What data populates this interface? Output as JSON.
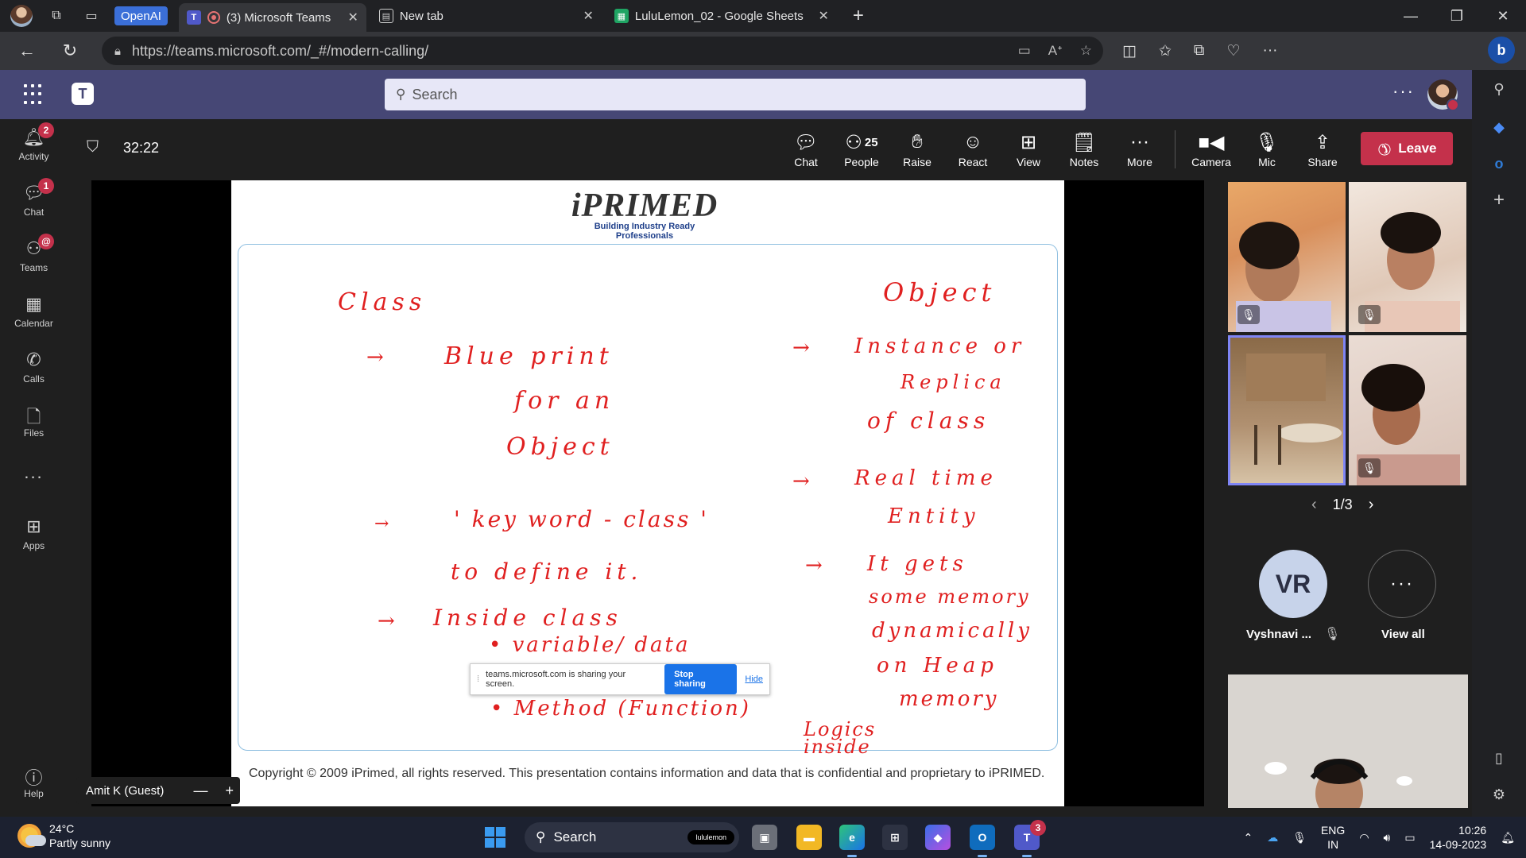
{
  "browser": {
    "openai_chip": "OpenAI",
    "tabs": [
      {
        "title": "(3) Microsoft Teams",
        "active": true
      },
      {
        "title": "New tab",
        "active": false
      },
      {
        "title": "LuluLemon_02 - Google Sheets",
        "active": false
      }
    ],
    "url": "https://teams.microsoft.com/_#/modern-calling/"
  },
  "teams": {
    "search_placeholder": "Search",
    "rail": [
      {
        "label": "Activity",
        "badge": "2",
        "icon": "bell-icon"
      },
      {
        "label": "Chat",
        "badge": "1",
        "icon": "chat-icon"
      },
      {
        "label": "Teams",
        "badge": "@",
        "icon": "teams-icon"
      },
      {
        "label": "Calendar",
        "badge": "",
        "icon": "calendar-icon"
      },
      {
        "label": "Calls",
        "badge": "",
        "icon": "phone-icon"
      },
      {
        "label": "Files",
        "badge": "",
        "icon": "file-icon"
      },
      {
        "label": "...",
        "badge": "",
        "icon": "more-icon"
      },
      {
        "label": "Apps",
        "badge": "",
        "icon": "apps-icon"
      },
      {
        "label": "Help",
        "badge": "",
        "icon": "help-icon"
      }
    ]
  },
  "meeting": {
    "timer": "32:22",
    "toolbar": {
      "chat": "Chat",
      "people": "People",
      "people_count": "25",
      "raise": "Raise",
      "react": "React",
      "view": "View",
      "notes": "Notes",
      "more": "More",
      "camera": "Camera",
      "mic": "Mic",
      "share": "Share",
      "leave": "Leave"
    },
    "presenter_name": "Amit K (Guest)",
    "pager": "1/3",
    "participant_initials": "VR",
    "participant_name": "Vyshnavi ...",
    "view_all": "View all"
  },
  "slide": {
    "logo_brand": "iPRIMED",
    "logo_tagline": "Building Industry Ready Professionals",
    "left_column": {
      "heading": "Class",
      "point1_arrow": "→",
      "point1_line1": "Blue print",
      "point1_line2": "for an",
      "point1_line3": "Object",
      "point2_arrow": "→",
      "point2_line1": "' key word - class '",
      "point2_line2": "to define it.",
      "point3_arrow": "→",
      "point3_line1": "Inside class",
      "point3_line2": "• variable/ data",
      "point3_line3": "• Method (Function)",
      "note": "Logics inside"
    },
    "right_column": {
      "heading": "Object",
      "point1_arrow": "→",
      "point1_line1": "Instance or",
      "point1_line2": "Replica",
      "point1_line3": "of class",
      "point2_arrow": "→",
      "point2_line1": "Real time",
      "point2_line2": "Entity",
      "point3_arrow": "→",
      "point3_line1": "It gets",
      "point3_line2": "some memory",
      "point3_line3": "dynamically",
      "point3_line4": "on Heap",
      "point3_line5": "memory"
    },
    "copyright": "Copyright © 2009 iPrimed, all rights reserved. This presentation contains information  and data  that is confidential and proprietary to iPRIMED.",
    "share_notice": "teams.microsoft.com is sharing your screen.",
    "stop_sharing": "Stop sharing",
    "hide": "Hide"
  },
  "taskbar": {
    "temperature": "24°C",
    "weather": "Partly sunny",
    "search": "Search",
    "search_pill": "lululemon",
    "teams_badge": "3",
    "lang_line1": "ENG",
    "lang_line2": "IN",
    "time": "10:26",
    "date": "14-09-2023"
  }
}
